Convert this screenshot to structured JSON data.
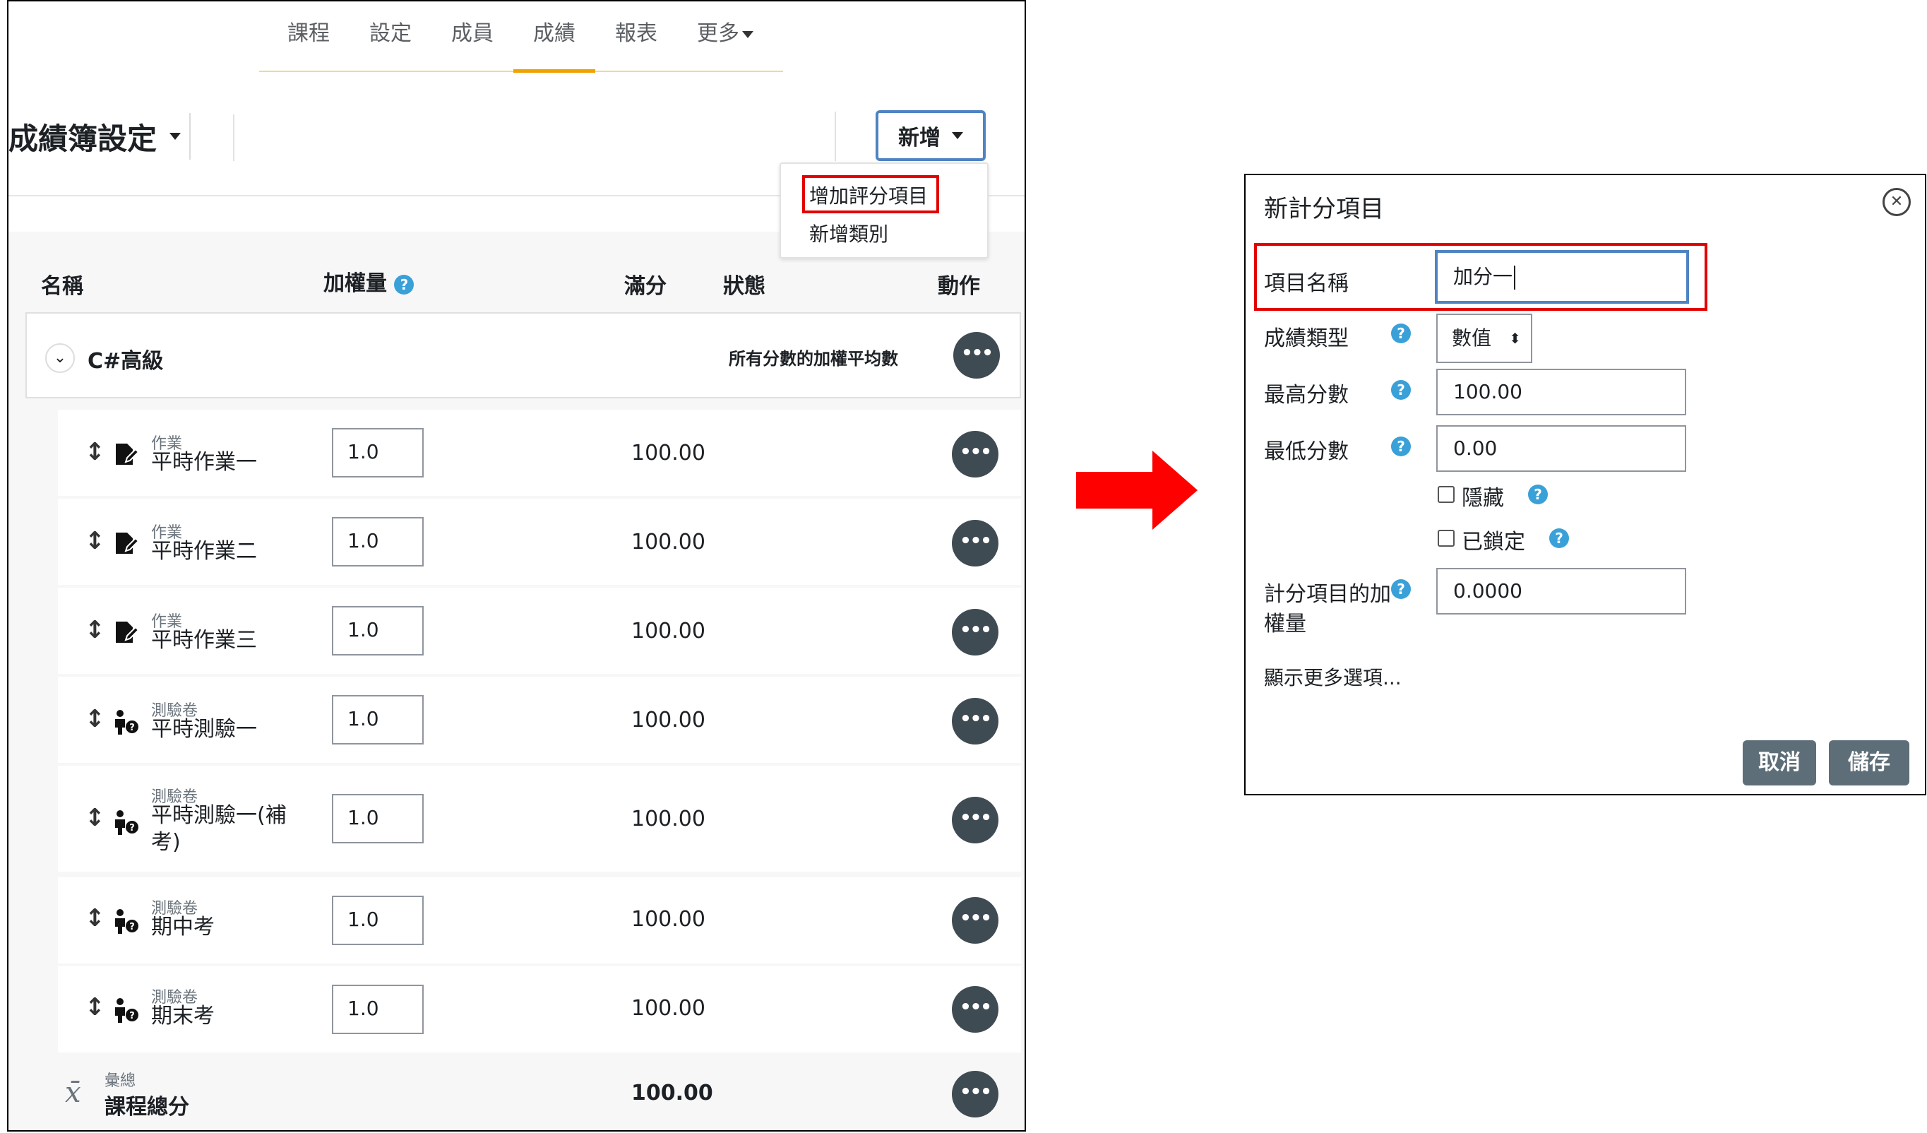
{
  "nav": {
    "items": [
      "課程",
      "設定",
      "成員",
      "成績",
      "報表",
      "更多"
    ],
    "active": "成績"
  },
  "page_title": "成績簿設定",
  "add_button": {
    "label": "新增",
    "menu": [
      "增加評分項目",
      "新增類別"
    ],
    "highlighted": "增加評分項目"
  },
  "table": {
    "headers": {
      "name": "名稱",
      "weight": "加權量",
      "max": "滿分",
      "status": "狀態",
      "action": "動作"
    },
    "category": {
      "name": "C#高級",
      "status": "所有分數的加權平均數"
    },
    "items": [
      {
        "type": "作業",
        "name": "平時作業一",
        "weight": "1.0",
        "max": "100.00",
        "icon": "assignment-icon"
      },
      {
        "type": "作業",
        "name": "平時作業二",
        "weight": "1.0",
        "max": "100.00",
        "icon": "assignment-icon"
      },
      {
        "type": "作業",
        "name": "平時作業三",
        "weight": "1.0",
        "max": "100.00",
        "icon": "assignment-icon"
      },
      {
        "type": "測驗卷",
        "name": "平時測驗一",
        "weight": "1.0",
        "max": "100.00",
        "icon": "quiz-icon"
      },
      {
        "type": "測驗卷",
        "name": "平時測驗一(補考)",
        "weight": "1.0",
        "max": "100.00",
        "icon": "quiz-icon"
      },
      {
        "type": "測驗卷",
        "name": "期中考",
        "weight": "1.0",
        "max": "100.00",
        "icon": "quiz-icon"
      },
      {
        "type": "測驗卷",
        "name": "期末考",
        "weight": "1.0",
        "max": "100.00",
        "icon": "quiz-icon"
      }
    ],
    "total": {
      "type": "彙總",
      "name": "課程總分",
      "max": "100.00",
      "icon": "sigma-icon"
    }
  },
  "modal": {
    "title": "新計分項目",
    "fields": {
      "item_name": {
        "label": "項目名稱",
        "value": "加分一"
      },
      "grade_type": {
        "label": "成績類型",
        "value": "數值"
      },
      "max_grade": {
        "label": "最高分數",
        "value": "100.00"
      },
      "min_grade": {
        "label": "最低分數",
        "value": "0.00"
      },
      "hidden": {
        "label": "隱藏",
        "checked": false
      },
      "locked": {
        "label": "已鎖定",
        "checked": false
      },
      "weight": {
        "label_line1": "計分項目的加",
        "label_line2": "權量",
        "value": "0.0000"
      }
    },
    "more_options": "顯示更多選項...",
    "cancel": "取消",
    "save": "儲存"
  },
  "colors": {
    "accent_nav": "#f0a202",
    "focus_border": "#4f83c2",
    "highlight_red": "#e30000",
    "arrow_red": "#ff0000",
    "action_button": "#3f4b52",
    "modal_button": "#5e6e78",
    "help_icon": "#3aa0d8"
  }
}
